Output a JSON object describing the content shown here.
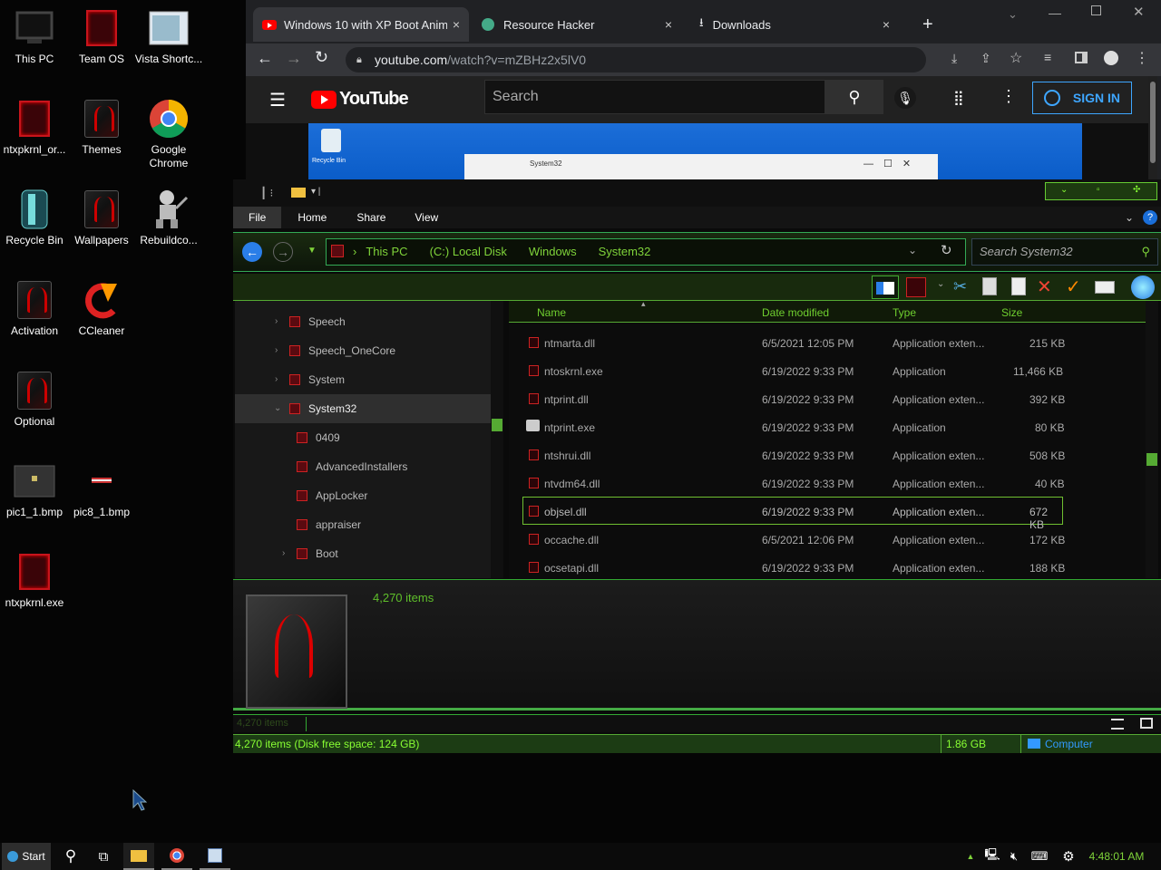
{
  "desktop": {
    "icons": [
      {
        "label": "This PC"
      },
      {
        "label": "Team OS"
      },
      {
        "label": "Vista Shortc..."
      },
      {
        "label": "ntxpkrnl_or..."
      },
      {
        "label": "Themes"
      },
      {
        "label": "Google Chrome"
      },
      {
        "label": "Recycle Bin"
      },
      {
        "label": "Wallpapers"
      },
      {
        "label": "Rebuildco..."
      },
      {
        "label": "Activation"
      },
      {
        "label": "CCleaner"
      },
      {
        "label": "Optional"
      },
      {
        "label": "pic1_1.bmp"
      },
      {
        "label": "pic8_1.bmp"
      },
      {
        "label": "ntxpkrnl.exe"
      }
    ]
  },
  "browser": {
    "tabs": [
      {
        "title": "Windows 10 with XP Boot Anima",
        "close": "×"
      },
      {
        "title": "Resource Hacker",
        "close": "×"
      },
      {
        "title": "Downloads",
        "close": "×"
      }
    ],
    "new_tab": "+",
    "url_host": "youtube.com",
    "url_path": "/watch?v=mZBHz2x5lV0",
    "youtube": {
      "logo": "YouTube",
      "search_placeholder": "Search",
      "sign_in": "SIGN IN"
    },
    "video_snippet": {
      "recycle": "Recycle Bin",
      "window_title": "System32"
    }
  },
  "explorer": {
    "ribbon_tabs": [
      "File",
      "Home",
      "Share",
      "View"
    ],
    "breadcrumb": [
      "This PC",
      "(C:) Local Disk",
      "Windows",
      "System32"
    ],
    "search_placeholder": "Search System32",
    "tree": [
      {
        "label": "Speech",
        "expander": "›"
      },
      {
        "label": "Speech_OneCore",
        "expander": "›"
      },
      {
        "label": "System",
        "expander": "›"
      },
      {
        "label": "System32",
        "expander": "⌄",
        "selected": true
      },
      {
        "label": "0409",
        "expander": ""
      },
      {
        "label": "AdvancedInstallers",
        "expander": ""
      },
      {
        "label": "AppLocker",
        "expander": ""
      },
      {
        "label": "appraiser",
        "expander": ""
      },
      {
        "label": "Boot",
        "expander": "›"
      }
    ],
    "columns": [
      "Name",
      "Date modified",
      "Type",
      "Size"
    ],
    "rows": [
      {
        "name": "ntmarta.dll",
        "date": "6/5/2021 12:05 PM",
        "type": "Application exten...",
        "size": "215 KB"
      },
      {
        "name": "ntoskrnl.exe",
        "date": "6/19/2022 9:33 PM",
        "type": "Application",
        "size": "11,466 KB"
      },
      {
        "name": "ntprint.dll",
        "date": "6/19/2022 9:33 PM",
        "type": "Application exten...",
        "size": "392 KB"
      },
      {
        "name": "ntprint.exe",
        "date": "6/19/2022 9:33 PM",
        "type": "Application",
        "size": "80 KB"
      },
      {
        "name": "ntshrui.dll",
        "date": "6/19/2022 9:33 PM",
        "type": "Application exten...",
        "size": "508 KB"
      },
      {
        "name": "ntvdm64.dll",
        "date": "6/19/2022 9:33 PM",
        "type": "Application exten...",
        "size": "40 KB"
      },
      {
        "name": "objsel.dll",
        "date": "6/19/2022 9:33 PM",
        "type": "Application exten...",
        "size": "672 KB",
        "selected": true
      },
      {
        "name": "occache.dll",
        "date": "6/5/2021 12:06 PM",
        "type": "Application exten...",
        "size": "172 KB"
      },
      {
        "name": "ocsetapi.dll",
        "date": "6/19/2022 9:33 PM",
        "type": "Application exten...",
        "size": "188 KB"
      }
    ],
    "item_count": "4,270 items",
    "status_left": "4,270 items (Disk free space: 124 GB)",
    "status_size": "1.86 GB",
    "status_location": "Computer"
  },
  "taskbar": {
    "start": "Start",
    "clock": "4:48:01 AM"
  },
  "colors": {
    "accent": "#7fd33a",
    "brand_red": "#c8141c",
    "link": "#3ea6ff"
  }
}
